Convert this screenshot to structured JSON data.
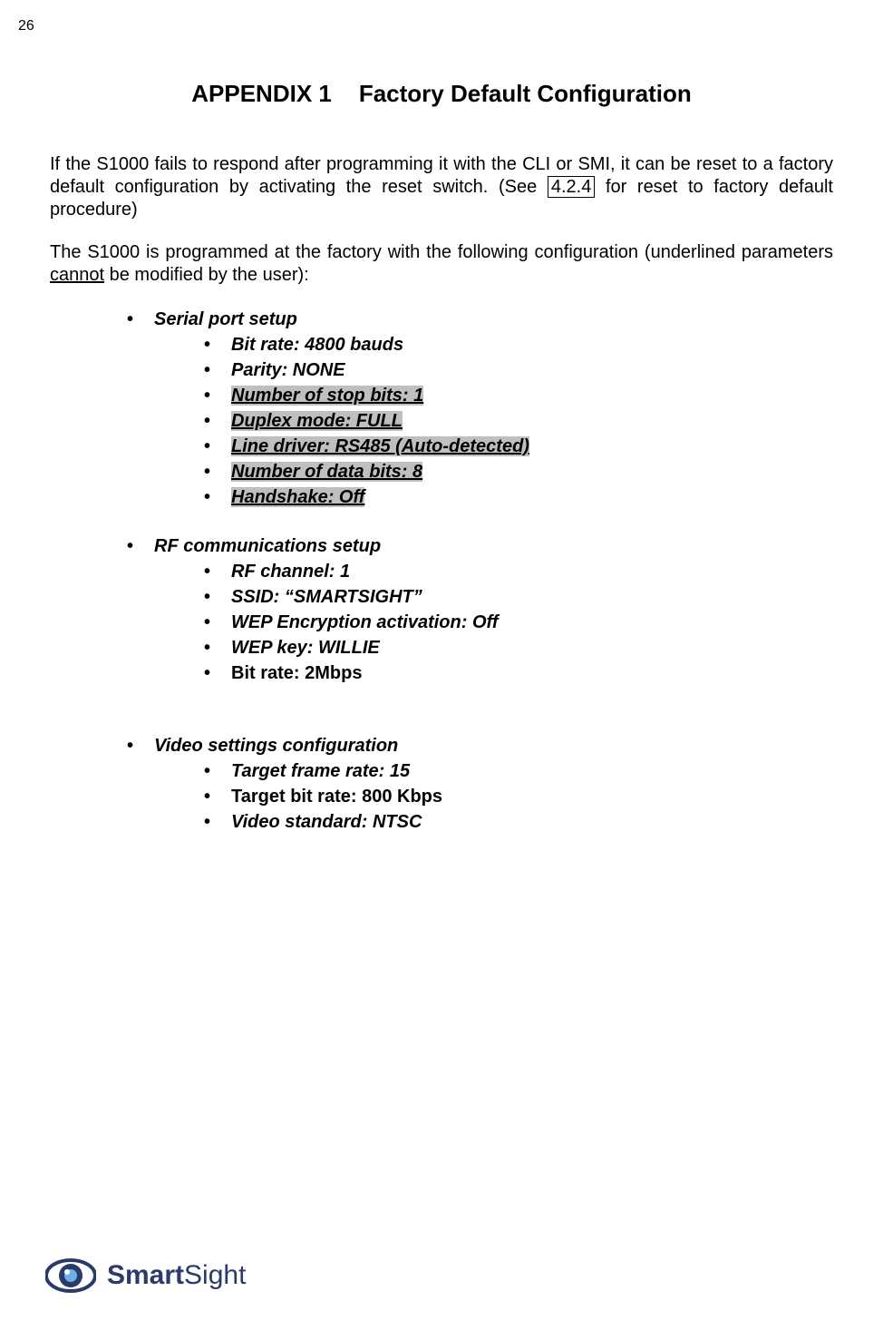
{
  "page_number": "26",
  "title_part1": "APPENDIX 1",
  "title_part2": "Factory Default Configuration",
  "para1_pre": "If the S1000 fails to respond after programming it with the CLI or SMI, it can be reset to a factory default configuration by activating the reset switch. (See ",
  "para1_link": "4.2.4",
  "para1_post": " for reset to factory default procedure)",
  "para2_pre": "The S1000 is programmed at the factory with the following configuration (underlined parameters ",
  "para2_cannot": "cannot",
  "para2_post": " be modified by the user):",
  "group1": {
    "heading": "Serial port setup",
    "items": [
      {
        "text": "Bit rate: 4800 bauds",
        "hl": false,
        "italic": true
      },
      {
        "text": "Parity: NONE",
        "hl": false,
        "italic": true
      },
      {
        "text": "Number of stop bits: 1",
        "hl": true,
        "italic": true
      },
      {
        "text": "Duplex mode: FULL",
        "hl": true,
        "italic": true
      },
      {
        "text": "Line driver: RS485 (Auto-detected)",
        "hl": true,
        "italic": true
      },
      {
        "text": "Number of data bits: 8",
        "hl": true,
        "italic": true
      },
      {
        "text": "Handshake: Off",
        "hl": true,
        "italic": true
      }
    ]
  },
  "group2": {
    "heading": "RF communications setup",
    "items": [
      {
        "text": "RF channel: 1",
        "hl": false,
        "italic": true
      },
      {
        "text": "SSID: “SMARTSIGHT”",
        "hl": false,
        "italic": true
      },
      {
        "text": "WEP Encryption activation: Off",
        "hl": false,
        "italic": true
      },
      {
        "text": "WEP key: WILLIE",
        "hl": false,
        "italic": true
      },
      {
        "text": "Bit rate: 2Mbps",
        "hl": false,
        "italic": false
      }
    ]
  },
  "group3": {
    "heading": "Video settings configuration",
    "items": [
      {
        "text": "Target frame rate: 15",
        "hl": false,
        "italic": true
      },
      {
        "text": "Target bit rate: 800 Kbps",
        "hl": false,
        "italic": false
      },
      {
        "text": "Video standard: NTSC",
        "hl": false,
        "italic": true
      }
    ]
  },
  "logo": {
    "brand_bold": "Smart",
    "brand_rest": "Sight"
  }
}
